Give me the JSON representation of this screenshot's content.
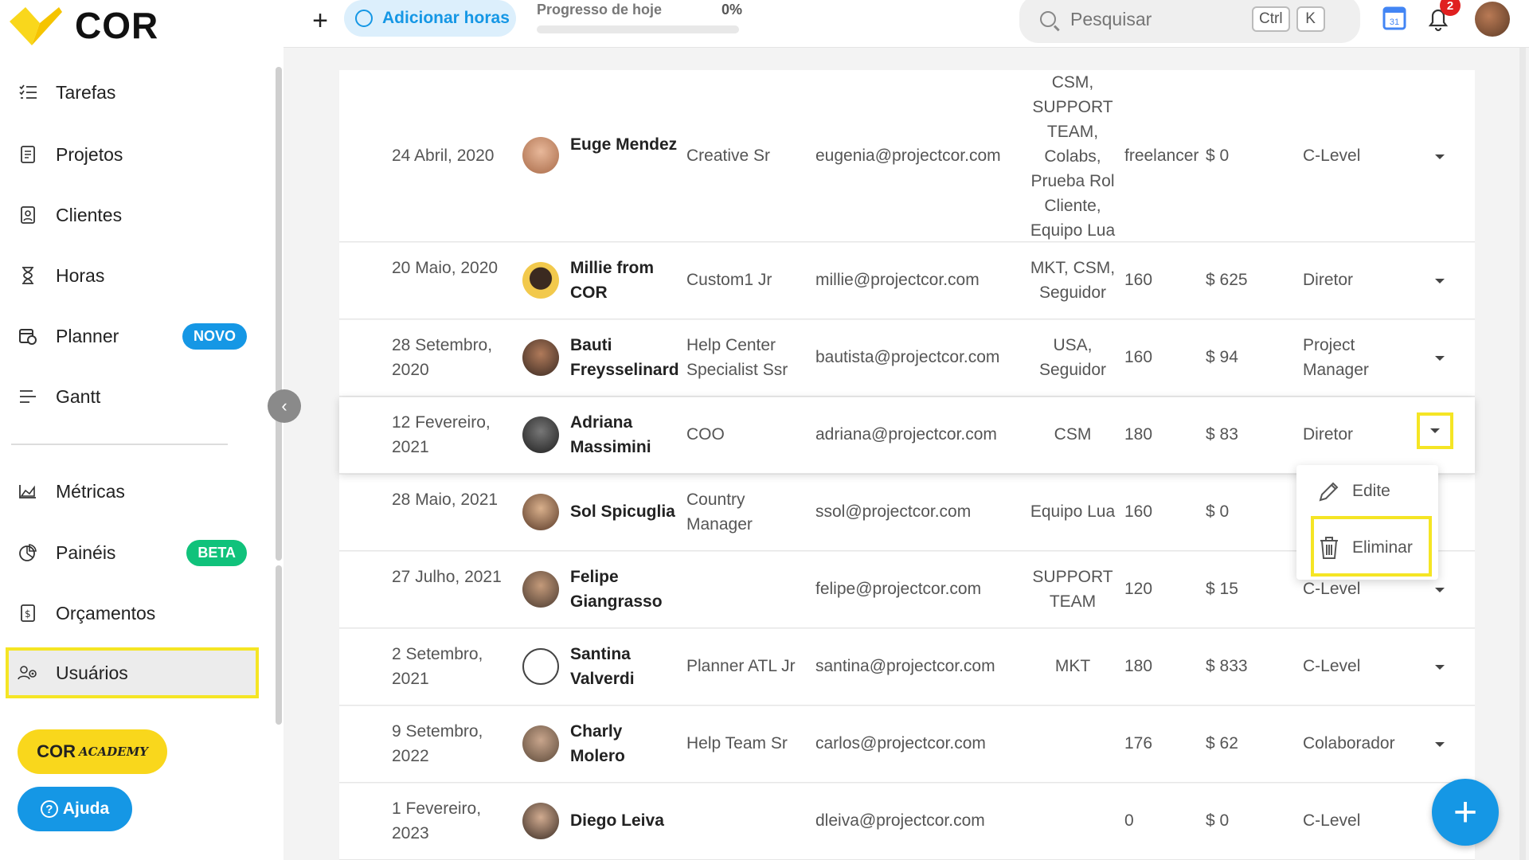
{
  "app": {
    "logo_text": "COR"
  },
  "sidebar": {
    "items": [
      {
        "label": "Tarefas",
        "icon": "task-list-icon"
      },
      {
        "label": "Projetos",
        "icon": "document-icon"
      },
      {
        "label": "Clientes",
        "icon": "contact-card-icon"
      },
      {
        "label": "Horas",
        "icon": "hourglass-icon"
      },
      {
        "label": "Planner",
        "icon": "calendar-clock-icon",
        "badge": "NOVO"
      },
      {
        "label": "Gantt",
        "icon": "gantt-lines-icon"
      },
      {
        "label": "Métricas",
        "icon": "area-chart-icon"
      },
      {
        "label": "Painéis",
        "icon": "pie-chart-icon",
        "badge": "BETA"
      },
      {
        "label": "Orçamentos",
        "icon": "invoice-icon"
      },
      {
        "label": "Usuários",
        "icon": "users-gear-icon"
      }
    ],
    "academy_label": "COR",
    "academy_script": "ACADEMY",
    "help_label": "Ajuda"
  },
  "topbar": {
    "add_hours_label": "Adicionar horas",
    "progress_label": "Progresso de hoje",
    "progress_value": "0%",
    "search_placeholder": "Pesquisar",
    "kbd_ctrl": "Ctrl",
    "kbd_k": "K",
    "calendar_day": "31",
    "notification_count": "2"
  },
  "users": [
    {
      "date": "24 Abril, 2020",
      "name": "Euge Mendez",
      "role": "Creative Sr",
      "email": "eugenia@projectcor.com",
      "team": "CSM, SUPPORT TEAM, Colabs, Prueba Rol Cliente, Equipo Lua",
      "hours": "freelancer",
      "cost": "$ 0",
      "level": "C-Level"
    },
    {
      "date": "20 Maio, 2020",
      "name": "Millie from COR",
      "role": "Custom1 Jr",
      "email": "millie@projectcor.com",
      "team": "MKT, CSM, Seguidor",
      "hours": "160",
      "cost": "$ 625",
      "level": "Diretor"
    },
    {
      "date": "28 Setembro, 2020",
      "name": "Bauti Freysselinard",
      "role": "Help Center Specialist Ssr",
      "email": "bautista@projectcor.com",
      "team": "USA, Seguidor",
      "hours": "160",
      "cost": "$ 94",
      "level": "Project Manager"
    },
    {
      "date": "12 Fevereiro, 2021",
      "name": "Adriana Massimini",
      "role": "COO",
      "email": "adriana@projectcor.com",
      "team": "CSM",
      "hours": "180",
      "cost": "$ 83",
      "level": "Diretor"
    },
    {
      "date": "28 Maio, 2021",
      "name": "Sol Spicuglia",
      "role": "Country Manager",
      "email": "ssol@projectcor.com",
      "team": "Equipo Lua",
      "hours": "160",
      "cost": "$ 0",
      "level": ""
    },
    {
      "date": "27 Julho, 2021",
      "name": "Felipe Giangrasso",
      "role": "",
      "email": "felipe@projectcor.com",
      "team": "SUPPORT TEAM",
      "hours": "120",
      "cost": "$ 15",
      "level": "C-Level"
    },
    {
      "date": "2 Setembro, 2021",
      "name": "Santina Valverdi",
      "role": "Planner ATL Jr",
      "email": "santina@projectcor.com",
      "team": "MKT",
      "hours": "180",
      "cost": "$ 833",
      "level": "C-Level"
    },
    {
      "date": "9 Setembro, 2022",
      "name": "Charly Molero",
      "role": "Help Team Sr",
      "email": "carlos@projectcor.com",
      "team": "",
      "hours": "176",
      "cost": "$ 62",
      "level": "Colaborador"
    },
    {
      "date": "1 Fevereiro, 2023",
      "name": "Diego Leiva",
      "role": "",
      "email": "dleiva@projectcor.com",
      "team": "",
      "hours": "0",
      "cost": "$ 0",
      "level": "C-Level"
    }
  ],
  "dropdown": {
    "edit_label": "Edite",
    "delete_label": "Eliminar"
  },
  "colors": {
    "brand_yellow": "#f9d71c",
    "accent_blue": "#1597e5",
    "highlight_yellow": "#f5e524",
    "beta_green": "#10c27b"
  }
}
